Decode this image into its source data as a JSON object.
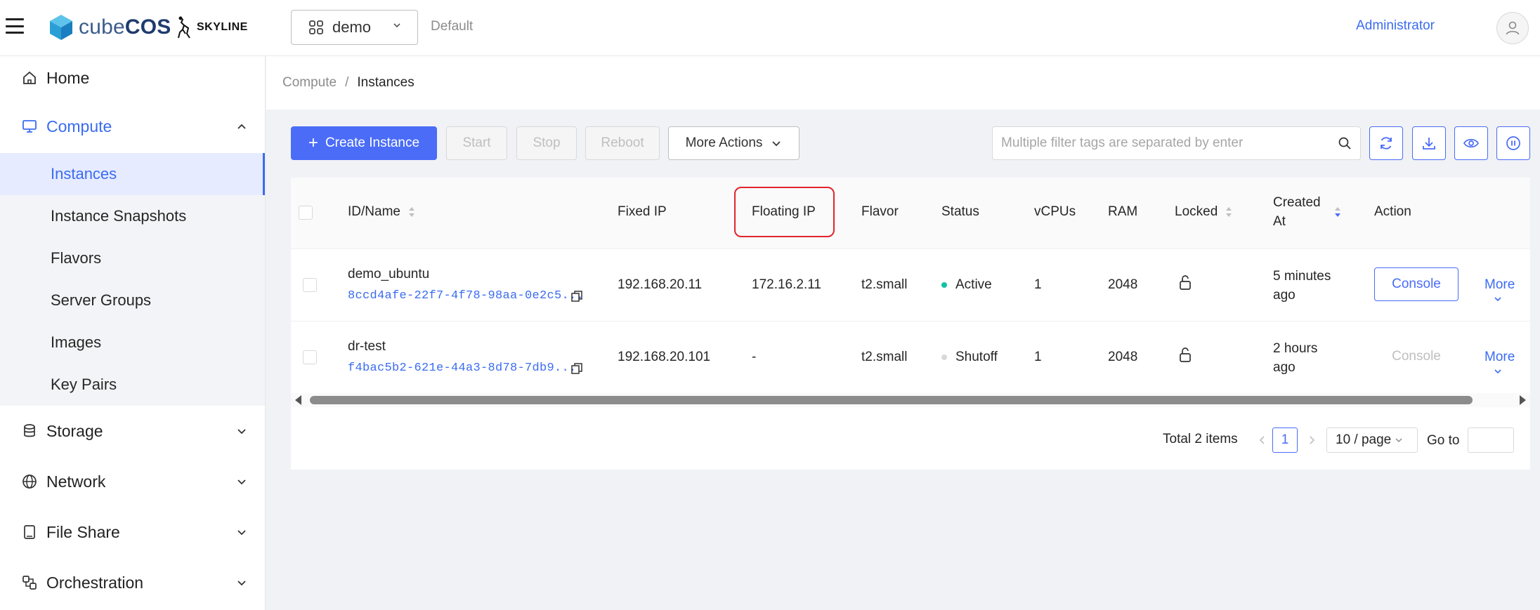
{
  "header": {
    "logo_cube": "cube",
    "logo_os": "OS",
    "skyline": "SKYLINE",
    "project": "demo",
    "domain": "Default",
    "user": "Administrator"
  },
  "sidebar": {
    "home": "Home",
    "compute": "Compute",
    "compute_items": [
      "Instances",
      "Instance Snapshots",
      "Flavors",
      "Server Groups",
      "Images",
      "Key Pairs"
    ],
    "storage": "Storage",
    "network": "Network",
    "file_share": "File Share",
    "orchestration": "Orchestration"
  },
  "breadcrumb": {
    "parent": "Compute",
    "separator": "/",
    "current": "Instances"
  },
  "toolbar": {
    "create": "Create Instance",
    "start": "Start",
    "stop": "Stop",
    "reboot": "Reboot",
    "more_actions": "More Actions",
    "search_placeholder": "Multiple filter tags are separated by enter"
  },
  "table": {
    "columns": {
      "id_name": "ID/Name",
      "fixed_ip": "Fixed IP",
      "floating_ip": "Floating IP",
      "flavor": "Flavor",
      "status": "Status",
      "vcpus": "vCPUs",
      "ram": "RAM",
      "locked": "Locked",
      "created_at_1": "Created",
      "created_at_2": "At",
      "action": "Action"
    },
    "rows": [
      {
        "name": "demo_ubuntu",
        "id": "8ccd4afe-22f7-4f78-98aa-0e2c5...",
        "fixed_ip": "192.168.20.11",
        "floating_ip": "172.16.2.11",
        "flavor": "t2.small",
        "status": "Active",
        "status_color": "#13c2a3",
        "vcpus": "1",
        "ram": "2048",
        "created_1": "5 minutes",
        "created_2": "ago",
        "console": "Console",
        "more": "More"
      },
      {
        "name": "dr-test",
        "id": "f4bac5b2-621e-44a3-8d78-7db9...",
        "fixed_ip": "192.168.20.101",
        "floating_ip": "-",
        "flavor": "t2.small",
        "status": "Shutoff",
        "status_color": "#d9d9d9",
        "vcpus": "1",
        "ram": "2048",
        "created_1": "2 hours",
        "created_2": "ago",
        "console": "Console",
        "more": "More"
      }
    ]
  },
  "pagination": {
    "total": "Total 2 items",
    "current_page": "1",
    "page_size": "10 / page",
    "goto": "Go to"
  },
  "colors": {
    "primary": "#4a6cf7",
    "highlight": "#e0242a"
  }
}
